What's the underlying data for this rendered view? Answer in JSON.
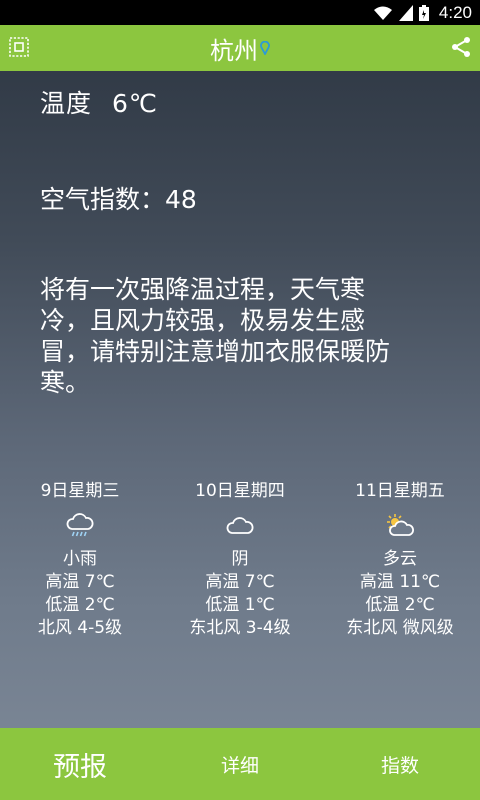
{
  "status_bar": {
    "time": "4:20"
  },
  "app_bar": {
    "title": "杭州"
  },
  "current": {
    "temp_label": "温度",
    "temp_value": "6℃",
    "aqi_text": "空气指数：48",
    "advice": "将有一次强降温过程，天气寒冷，且风力较强，极易发生感冒，请特别注意增加衣服保暖防寒。"
  },
  "forecast": [
    {
      "date": "9日星期三",
      "icon": "light-rain-icon",
      "condition": "小雨",
      "high": "高温 7℃",
      "low": "低温 2℃",
      "wind": "北风 4-5级"
    },
    {
      "date": "10日星期四",
      "icon": "cloudy-icon",
      "condition": "阴",
      "high": "高温 7℃",
      "low": "低温 1℃",
      "wind": "东北风 3-4级"
    },
    {
      "date": "11日星期五",
      "icon": "partly-cloudy-icon",
      "condition": "多云",
      "high": "高温 11℃",
      "low": "低温 2℃",
      "wind": "东北风 微风级"
    }
  ],
  "tabs": [
    "预报",
    "详细",
    "指数"
  ],
  "colors": {
    "accent": "#8cc63f",
    "location_pin": "#2a9bd8",
    "sun": "#f5c542"
  }
}
